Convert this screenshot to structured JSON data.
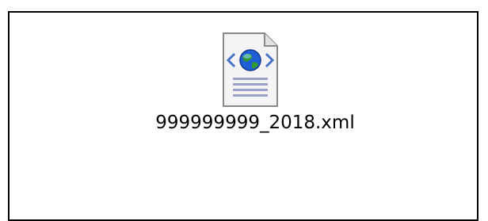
{
  "file": {
    "name": "999999999_2018.xml",
    "icon": "xml-file-globe-icon"
  },
  "colors": {
    "border": "#000000",
    "background": "#ffffff",
    "globe_blue": "#1f5fd6",
    "globe_green": "#2f9a2f",
    "page_lines": "#9aa3c7"
  }
}
